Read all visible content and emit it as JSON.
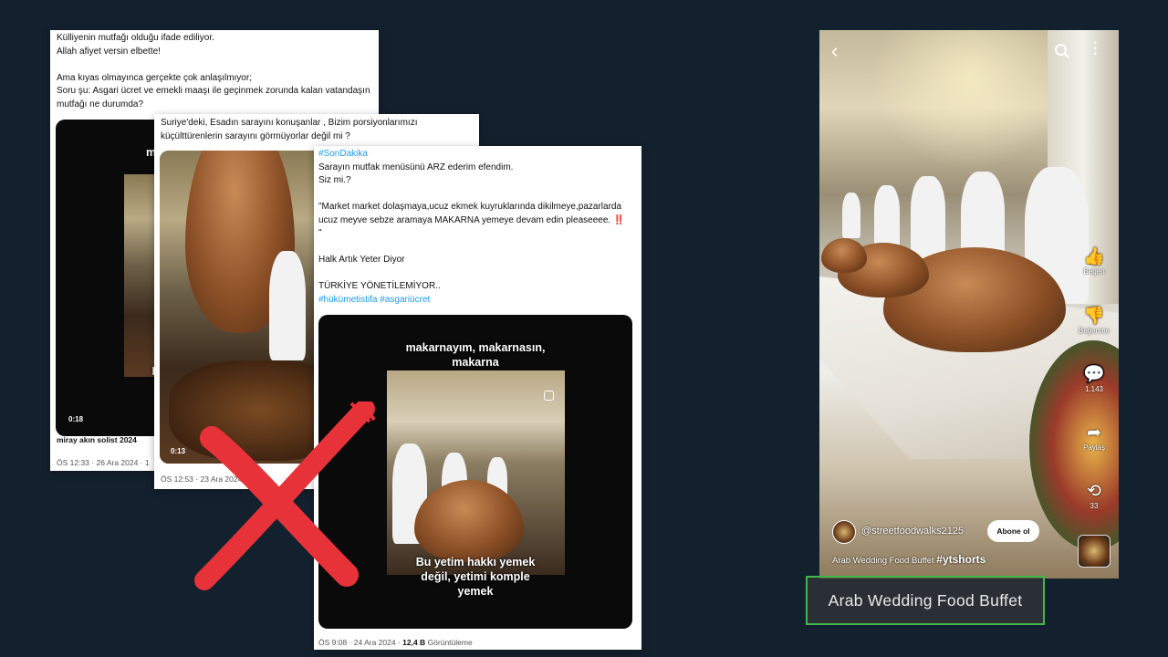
{
  "tweet1": {
    "text": "Külliyenin mutfağı olduğu ifade ediliyor.\nAllah afiyet versin elbette!\n\nAma kıyas olmayınca gerçekte çok anlaşılmıyor;\nSoru şu: Asgari ücret ve emekli maaşı ile geçinmek zorunda kalan vatandaşın mutfağı ne durumda?",
    "video_overlay_top": "ma",
    "video_overlay_bottom": "B",
    "duration": "0:18",
    "author": "miray akın solist 2024",
    "timestamp": "ÖS 12:33 · 26 Ara 2024 · 1"
  },
  "tweet2": {
    "text": "Suriye'deki, Esadın sarayını konuşanlar , Bizim porsiyonlarımızı küçülttürenlerin sarayını görmüyorlar değil mi ?",
    "duration": "0:13",
    "timestamp": "ÖS 12:53 · 23 Ara 2024"
  },
  "tweet3": {
    "hashtag_top": "#SonDakika",
    "text": "Sarayın mutfak menüsünü ARZ ederim efendim.\nSiz mi.?\n\n\"Market market dolaşmaya,ucuz ekmek kuyruklarında dikilmeye,pazarlarda ucuz meyve sebze aramaya MAKARNA yemeye devam edin pleaseeee. ‼️ \"\n\nHalk Artık Yeter Diyor\n\nTÜRKİYE YÖNETİLEMİYOR..",
    "hashtags_bottom": "#hükümetistifa #asgariücret",
    "video_overlay_top": "makarnayım, makarnasın,\nmakarna",
    "video_overlay_bottom": "Bu yetim hakkı yemek\ndeğil, yetimi komple\nyemek",
    "timestamp": "ÖS 9:08 · 24 Ara 2024 · ",
    "views_count": "12,4 B",
    "views_label": "Görüntüleme"
  },
  "phone": {
    "actions": [
      {
        "icon": "thumbs-up-icon",
        "glyph": "👍",
        "label": "Beğen"
      },
      {
        "icon": "thumbs-down-icon",
        "glyph": "👎",
        "label": "Beğenme"
      },
      {
        "icon": "comment-icon",
        "glyph": "💬",
        "label": "1.143"
      },
      {
        "icon": "share-icon",
        "glyph": "➦",
        "label": "Paylaş"
      },
      {
        "icon": "remix-icon",
        "glyph": "⟲",
        "label": "33"
      }
    ],
    "channel": "@streetfoodwalks2125",
    "subscribe": "Abone ol",
    "title": "Arab Wedding Food Buffet",
    "hashtag": "#ytshorts"
  },
  "caption": "Arab Wedding Food Buffet",
  "colors": {
    "background": "#13212e",
    "link": "#1d9bf0",
    "cross": "#e8323a",
    "caption_border": "#3fb84a"
  }
}
